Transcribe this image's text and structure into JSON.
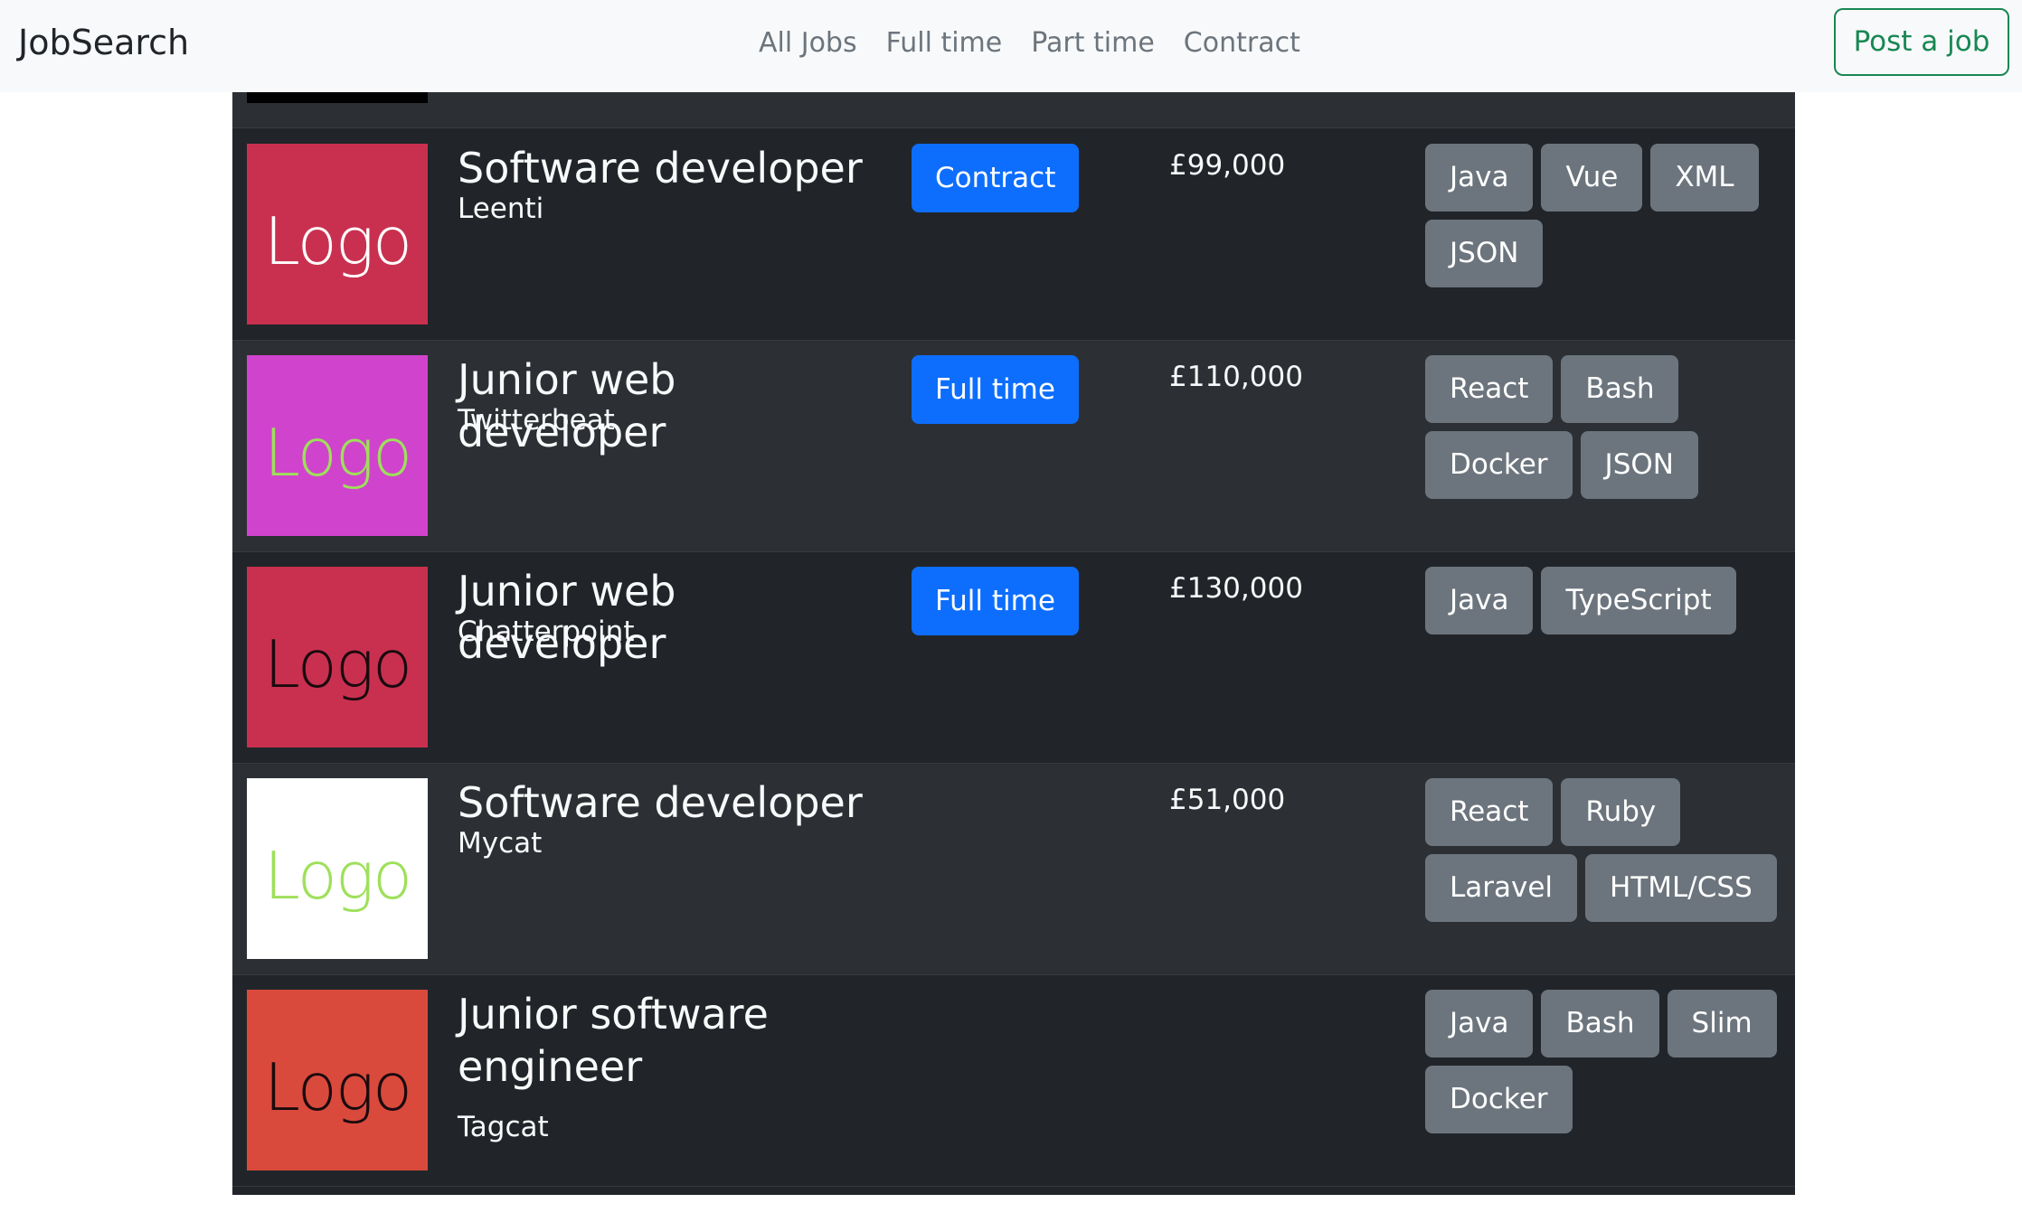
{
  "navbar": {
    "brand": "JobSearch",
    "links": [
      "All Jobs",
      "Full time",
      "Part time",
      "Contract"
    ],
    "post_button": "Post a job"
  },
  "jobs": [
    {
      "title": "Software developer",
      "company": "Leenti",
      "type": "Contract",
      "salary": "£99,000",
      "logo_text": "Logo",
      "logo_bg": "#c9304f",
      "logo_fg": "#ffffff",
      "tags": [
        "Java",
        "Vue",
        "XML",
        "JSON"
      ]
    },
    {
      "title": "Junior web developer",
      "company": "Twitterbeat",
      "type": "Full time",
      "salary": "£110,000",
      "logo_text": "Logo",
      "logo_bg": "#d044cd",
      "logo_fg": "#9ee05a",
      "tags": [
        "React",
        "Bash",
        "Docker",
        "JSON"
      ]
    },
    {
      "title": "Junior web developer",
      "company": "Chatterpoint",
      "type": "Full time",
      "salary": "£130,000",
      "logo_text": "Logo",
      "logo_bg": "#c9304f",
      "logo_fg": "#1a0a0e",
      "tags": [
        "Java",
        "TypeScript"
      ]
    },
    {
      "title": "Software developer",
      "company": "Mycat",
      "type": "",
      "salary": "£51,000",
      "logo_text": "Logo",
      "logo_bg": "#ffffff",
      "logo_fg": "#9ee05a",
      "tags": [
        "React",
        "Ruby",
        "Laravel",
        "HTML/CSS"
      ]
    },
    {
      "title": "Junior software engineer",
      "company": "Tagcat",
      "type": "",
      "salary": "",
      "logo_text": "Logo",
      "logo_bg": "#d94a3c",
      "logo_fg": "#1a0a0e",
      "tags": [
        "Java",
        "Bash",
        "Slim",
        "Docker"
      ]
    }
  ]
}
